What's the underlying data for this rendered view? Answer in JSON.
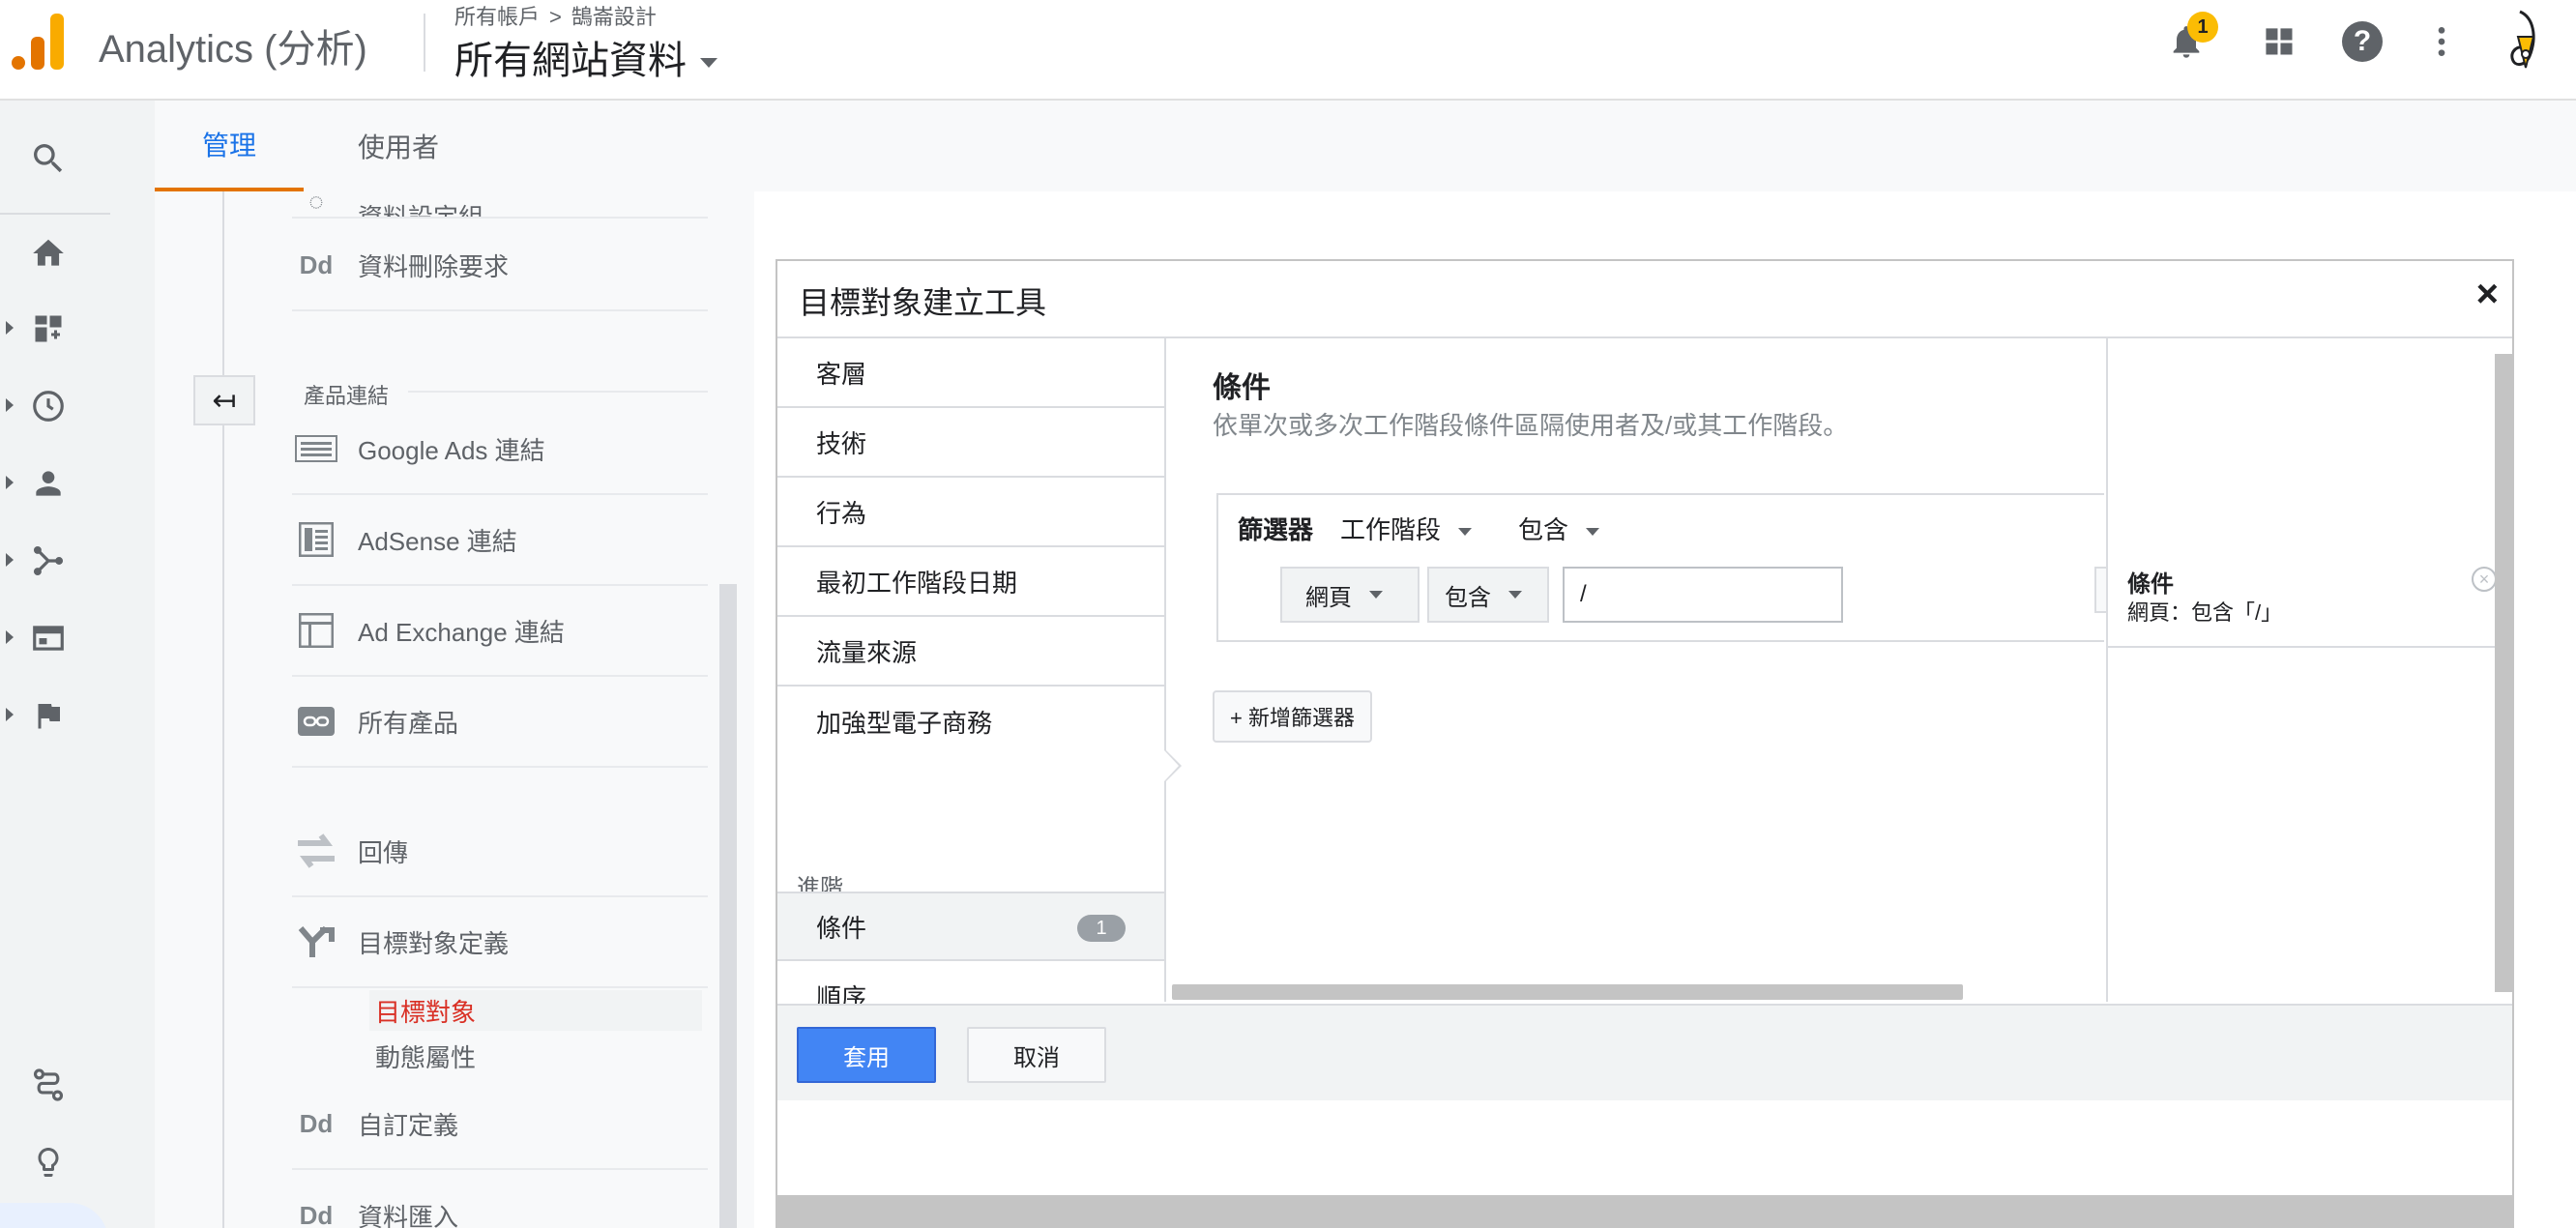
{
  "header": {
    "app_title": "Analytics (分析)",
    "breadcrumb_account": "所有帳戶",
    "breadcrumb_sep": ">",
    "breadcrumb_property": "鵠崙設計",
    "property_view": "所有網站資料",
    "notification_count": "1"
  },
  "tabs": {
    "admin": "管理",
    "users": "使用者"
  },
  "admin_panel": {
    "partial_item": "資料設定組",
    "data_deletion": "資料刪除要求",
    "product_links_heading": "產品連結",
    "google_ads": "Google Ads 連結",
    "adsense": "AdSense 連結",
    "ad_exchange": "Ad Exchange 連結",
    "all_products": "所有產品",
    "postbacks": "回傳",
    "audience_definitions": "目標對象定義",
    "audiences": "目標對象",
    "dynamic_attributes": "動態屬性",
    "custom_definitions": "自訂定義",
    "data_import": "資料匯入",
    "dd_icon": "Dd"
  },
  "modal": {
    "title": "目標對象建立工具",
    "close": "×",
    "categories": [
      "客層",
      "技術",
      "行為",
      "最初工作階段日期",
      "流量來源",
      "加強型電子商務"
    ],
    "advanced_label": "進階",
    "advanced_items": [
      {
        "label": "條件",
        "badge": "1"
      },
      {
        "label": "順序"
      }
    ],
    "condition": {
      "title": "條件",
      "description": "依單次或多次工作階段條件區隔使用者及/或其工作階段。",
      "filter_label": "篩選器",
      "scope_dropdown": "工作階段",
      "include_dropdown": "包含",
      "dimension_dropdown": "網頁",
      "operator_dropdown": "包含",
      "value_input": "/",
      "add_filter_button": "+ 新增篩選器"
    },
    "summary": {
      "title": "條件",
      "text": "網頁：包含「/」"
    },
    "apply_button": "套用",
    "cancel_button": "取消"
  },
  "colors": {
    "accent": "#1a73e8",
    "tab_underline": "#e37400",
    "active_link": "#d93025",
    "apply_button": "#4285f4",
    "badge": "#fbbc04"
  },
  "icons": [
    "search-icon",
    "home-icon",
    "dashboard-icon",
    "clock-icon",
    "person-icon",
    "acquisition-icon",
    "behavior-icon",
    "flag-icon",
    "attribution-icon",
    "lightbulb-icon",
    "bell-icon",
    "apps-icon",
    "help-icon",
    "more-vert-icon"
  ]
}
